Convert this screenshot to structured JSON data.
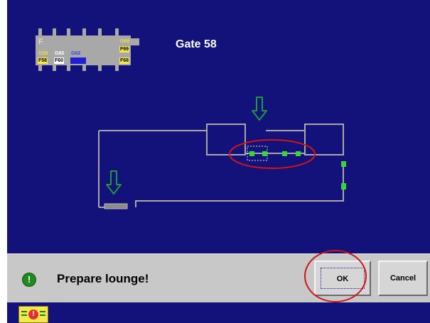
{
  "gate": {
    "title": "Gate 58"
  },
  "chip": {
    "letter": "F",
    "cells": {
      "g58": "G58",
      "g60": "G60",
      "g62": "G62",
      "g69": "G69",
      "f58": "F58",
      "f60": "F60",
      "f69": "F69",
      "f68": "F68"
    }
  },
  "status": {
    "message": "Prepare lounge!",
    "icon": "!"
  },
  "buttons": {
    "ok": "OK",
    "cancel": "Cancel"
  },
  "colors": {
    "background": "#12127a",
    "line": "#a8a8a8",
    "marker": "#35d635",
    "arrow": "#1f9a3a",
    "highlight": "#d21414",
    "bar": "#c8c8c8"
  },
  "footer": {
    "icon": "alert-panel-icon"
  }
}
